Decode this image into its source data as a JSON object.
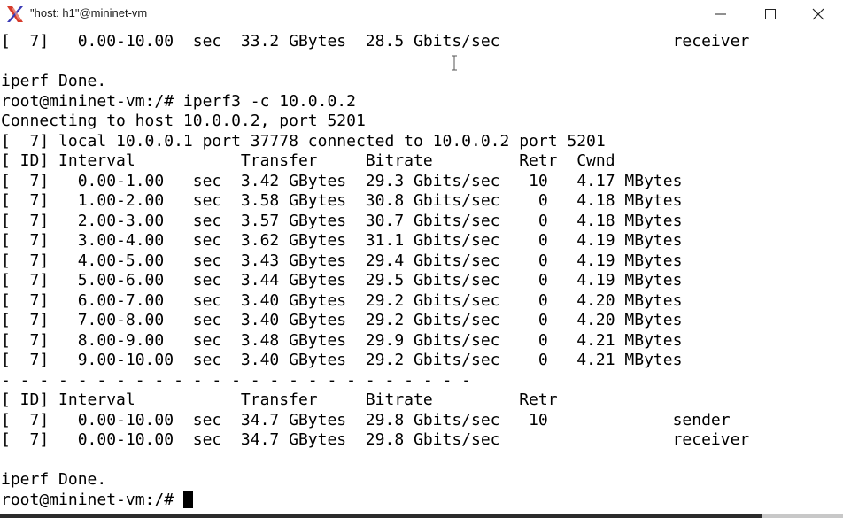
{
  "window": {
    "title": "\"host: h1\"@mininet-vm",
    "app_icon": "x11-icon",
    "controls": [
      "minimize-icon",
      "maximize-icon",
      "close-icon"
    ]
  },
  "terminal": {
    "lines": [
      "[  7]   0.00-10.00  sec  33.2 GBytes  28.5 Gbits/sec                  receiver",
      "",
      "iperf Done.",
      "root@mininet-vm:/# iperf3 -c 10.0.0.2",
      "Connecting to host 10.0.0.2, port 5201",
      "[  7] local 10.0.0.1 port 37778 connected to 10.0.0.2 port 5201",
      "[ ID] Interval           Transfer     Bitrate         Retr  Cwnd",
      "[  7]   0.00-1.00   sec  3.42 GBytes  29.3 Gbits/sec   10   4.17 MBytes",
      "[  7]   1.00-2.00   sec  3.58 GBytes  30.8 Gbits/sec    0   4.18 MBytes",
      "[  7]   2.00-3.00   sec  3.57 GBytes  30.7 Gbits/sec    0   4.18 MBytes",
      "[  7]   3.00-4.00   sec  3.62 GBytes  31.1 Gbits/sec    0   4.19 MBytes",
      "[  7]   4.00-5.00   sec  3.43 GBytes  29.4 Gbits/sec    0   4.19 MBytes",
      "[  7]   5.00-6.00   sec  3.44 GBytes  29.5 Gbits/sec    0   4.19 MBytes",
      "[  7]   6.00-7.00   sec  3.40 GBytes  29.2 Gbits/sec    0   4.20 MBytes",
      "[  7]   7.00-8.00   sec  3.40 GBytes  29.2 Gbits/sec    0   4.20 MBytes",
      "[  7]   8.00-9.00   sec  3.48 GBytes  29.9 Gbits/sec    0   4.21 MBytes",
      "[  7]   9.00-10.00  sec  3.40 GBytes  29.2 Gbits/sec    0   4.21 MBytes",
      "- - - - - - - - - - - - - - - - - - - - - - - - -",
      "[ ID] Interval           Transfer     Bitrate         Retr",
      "[  7]   0.00-10.00  sec  34.7 GBytes  29.8 Gbits/sec   10             sender",
      "[  7]   0.00-10.00  sec  34.7 GBytes  29.8 Gbits/sec                  receiver",
      "",
      "iperf Done."
    ],
    "prompt": "root@mininet-vm:/# "
  }
}
